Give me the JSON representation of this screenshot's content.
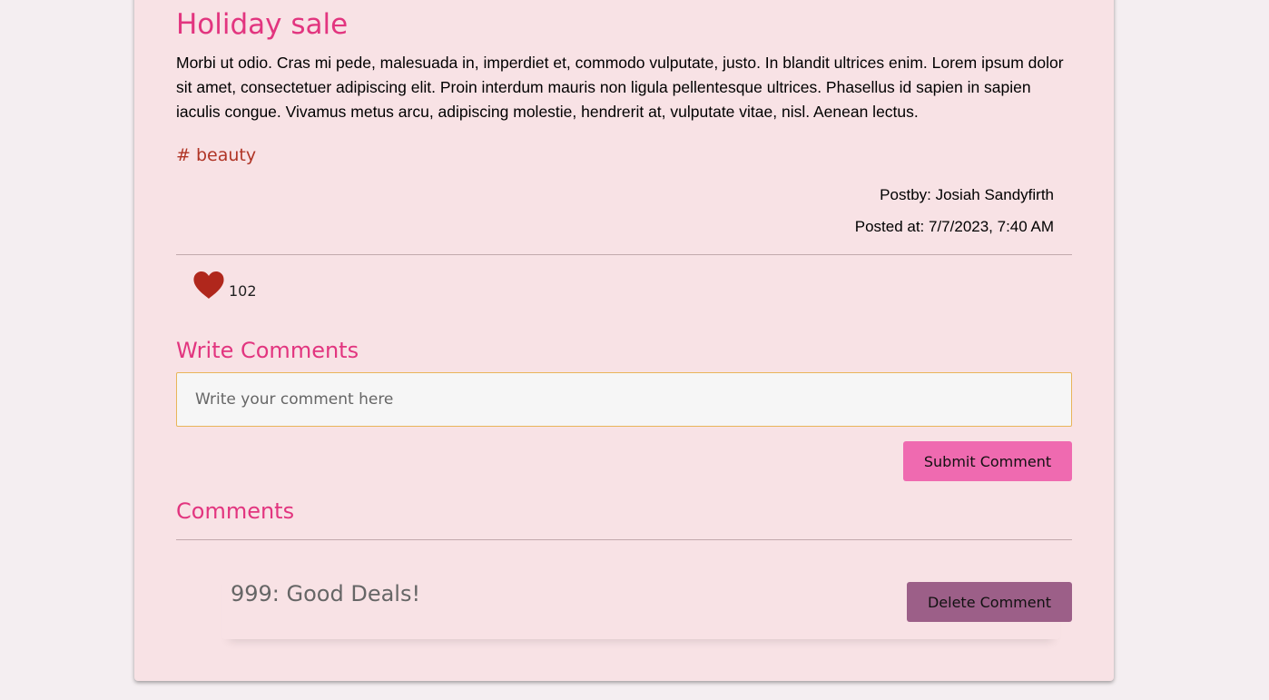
{
  "post": {
    "title": "Holiday sale",
    "body": "Morbi ut odio. Cras mi pede, malesuada in, imperdiet et, commodo vulputate, justo. In blandit ultrices enim. Lorem ipsum dolor sit amet, consectetuer adipiscing elit. Proin interdum mauris non ligula pellentesque ultrices. Phasellus id sapien in sapien iaculis congue. Vivamus metus arcu, adipiscing molestie, hendrerit at, vulputate vitae, nisl. Aenean lectus.",
    "tag": "# beauty",
    "author": "Postby: Josiah Sandyfirth",
    "posted_at": "Posted at: 7/7/2023, 7:40 AM",
    "likes": "102"
  },
  "write_comments": {
    "heading": "Write Comments",
    "placeholder": "Write your comment here",
    "value": "",
    "submit_label": "Submit Comment"
  },
  "comments": {
    "heading": "Comments",
    "items": [
      {
        "text": "999: Good Deals!",
        "delete_label": "Delete Comment"
      }
    ]
  },
  "colors": {
    "accent_pink": "#e2357f",
    "tag_red": "#b03526",
    "heart_red": "#b0271c",
    "card_background": "#f8e2e5",
    "submit_button": "#ef6ab0",
    "delete_button": "#9c5f88",
    "input_border": "#e9b55a"
  },
  "icons": {
    "like": "heart-icon"
  }
}
